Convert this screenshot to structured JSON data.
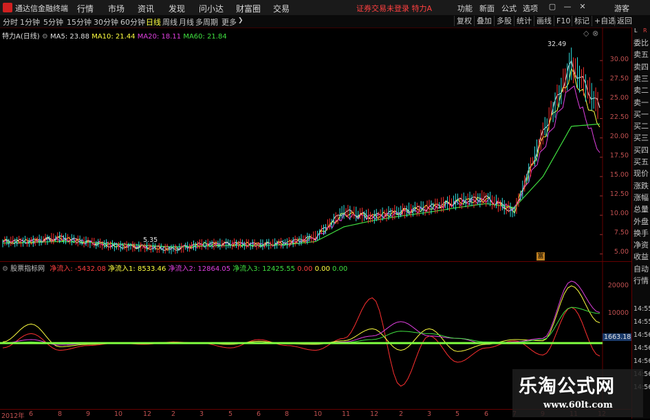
{
  "app": {
    "title": "通达信金融终端",
    "menu": [
      "行情",
      "市场",
      "资讯",
      "发现",
      "问小达",
      "财富圈",
      "交易"
    ],
    "notice": "证券交易未登录 特力A",
    "right_menu": [
      "功能",
      "新面",
      "公式",
      "选项"
    ],
    "guest": "游客",
    "window_buttons": [
      "▢",
      "—",
      "✕"
    ]
  },
  "toolbar": {
    "periods": [
      "分时",
      "1分钟",
      "5分钟",
      "15分钟",
      "30分钟",
      "60分钟",
      "日线",
      "周线",
      "月线",
      "多周期",
      "更多"
    ],
    "active_period": "日线",
    "right_buttons": [
      "复权",
      "叠加",
      "多股",
      "统计",
      "画线",
      "F10",
      "标记",
      "+自选",
      "返回"
    ],
    "more_arrow": "❯"
  },
  "price_panel": {
    "stock": "特力A",
    "period": "(日线)",
    "legend": [
      {
        "label": "MA5: 23.88",
        "color": "#e0e0e0"
      },
      {
        "label": "MA10: 21.44",
        "color": "#ffff40"
      },
      {
        "label": "MA20: 18.11",
        "color": "#e040e0"
      },
      {
        "label": "MA60: 21.84",
        "color": "#40e040"
      }
    ],
    "y_ticks": [
      "30.00",
      "27.50",
      "25.00",
      "22.50",
      "20.00",
      "17.50",
      "15.00",
      "12.50",
      "10.00",
      "7.50",
      "5.00"
    ],
    "high_label": "32.49",
    "low_label": "5.35",
    "ma_colors": {
      "ma5": "#e8e8e8",
      "ma10": "#ffff40",
      "ma20": "#e040e0",
      "ma60": "#40e040"
    }
  },
  "indicator_panel": {
    "name": "股票指标网",
    "legend": [
      {
        "label": "净流入: -5432.08",
        "color": "#ff4040"
      },
      {
        "label": "净流入1: 8533.46",
        "color": "#ffff40"
      },
      {
        "label": "净流入2: 12864.05",
        "color": "#e040e0"
      },
      {
        "label": "净流入3: 12425.55",
        "color": "#40e040"
      },
      {
        "label": "0.00",
        "color": "#ff4040"
      },
      {
        "label": "0.00",
        "color": "#ffff40"
      },
      {
        "label": "0.00",
        "color": "#40e040"
      }
    ],
    "y_ticks": [
      "20000",
      "10000"
    ],
    "current_value": "1663.18"
  },
  "x_axis": [
    "2012年",
    "6",
    "8",
    "9",
    "10",
    "12",
    "2",
    "3",
    "5",
    "6",
    "8",
    "10",
    "11",
    "12",
    "2",
    "3",
    "5",
    "6",
    "7",
    "9",
    "11",
    "12"
  ],
  "side_panel": {
    "top": [
      "L",
      "R"
    ],
    "items": [
      "委比",
      "卖五",
      "卖四",
      "卖三",
      "卖二",
      "卖一",
      "买一",
      "买二",
      "买三",
      "买四",
      "买五",
      "现价",
      "涨跌",
      "涨幅",
      "总量",
      "外盘",
      "换手",
      "净资",
      "收益",
      "自动",
      "行情"
    ],
    "times": [
      "14:55",
      "14:55",
      "14:56",
      "14:56",
      "14:56",
      "14:56",
      "14:56"
    ]
  },
  "watermark": {
    "line1": "乐淘公式网",
    "line2": "www.60lt.com"
  },
  "badge": "富",
  "chart_data": {
    "type": "line",
    "title": "特力A (日线)",
    "ylim": [
      4.5,
      32.5
    ],
    "x": [
      "2012年",
      "6",
      "8",
      "9",
      "10",
      "12",
      "2",
      "3",
      "5",
      "6",
      "8",
      "10",
      "11",
      "12",
      "2",
      "3",
      "5",
      "6",
      "7",
      "9",
      "11",
      "12"
    ],
    "series": [
      {
        "name": "MA5",
        "values": [
          6.6,
          6.6,
          7.1,
          6.5,
          6.0,
          5.9,
          5.6,
          6.2,
          6.3,
          6.2,
          6.4,
          7.2,
          10.5,
          9.8,
          10.5,
          11.0,
          11.8,
          12.2,
          10.5,
          20.5,
          29.5,
          23.9
        ]
      },
      {
        "name": "MA10",
        "values": [
          6.6,
          6.6,
          7.0,
          6.5,
          6.1,
          5.9,
          5.7,
          6.2,
          6.3,
          6.2,
          6.4,
          7.1,
          10.2,
          9.8,
          10.4,
          11.0,
          11.7,
          12.1,
          10.6,
          19.8,
          28.5,
          21.4
        ]
      },
      {
        "name": "MA20",
        "values": [
          6.5,
          6.6,
          6.9,
          6.5,
          6.2,
          6.0,
          5.8,
          6.1,
          6.3,
          6.2,
          6.3,
          7.0,
          9.9,
          9.8,
          10.3,
          10.9,
          11.6,
          12.0,
          10.8,
          18.5,
          27.0,
          18.1
        ]
      },
      {
        "name": "MA60",
        "values": [
          6.4,
          6.5,
          6.6,
          6.5,
          6.3,
          6.1,
          5.9,
          6.0,
          6.1,
          6.1,
          6.2,
          6.6,
          8.5,
          9.3,
          9.9,
          10.4,
          11.0,
          11.5,
          11.0,
          15.0,
          21.5,
          21.8
        ]
      }
    ],
    "indicator": {
      "ylim": [
        -25000,
        30000
      ],
      "series": [
        {
          "name": "净流入",
          "values": [
            -2000,
            4000,
            -3000,
            -1000,
            0,
            -500,
            500,
            0,
            -2000,
            1500,
            -1000,
            -3000,
            2000,
            19000,
            -18000,
            3000,
            -8000,
            -2000,
            1000,
            -5000,
            15000,
            -5432.08
          ]
        },
        {
          "name": "净流入1",
          "values": [
            500,
            8000,
            -1500,
            -500,
            0,
            200,
            300,
            0,
            -500,
            800,
            -300,
            -500,
            1000,
            6000,
            -3000,
            6000,
            -3500,
            -500,
            1500,
            1000,
            24000,
            8533.46
          ]
        },
        {
          "name": "净流入2",
          "values": [
            0,
            1500,
            -800,
            -200,
            0,
            100,
            200,
            0,
            -200,
            300,
            -100,
            -200,
            500,
            3000,
            9000,
            3000,
            2000,
            -300,
            500,
            2000,
            26000,
            12864.05
          ]
        },
        {
          "name": "净流入3",
          "values": [
            0,
            500,
            -300,
            -100,
            0,
            50,
            100,
            0,
            -100,
            100,
            -50,
            -100,
            200,
            1500,
            5000,
            4000,
            2000,
            500,
            300,
            1500,
            15000,
            12425.55
          ]
        }
      ]
    }
  }
}
